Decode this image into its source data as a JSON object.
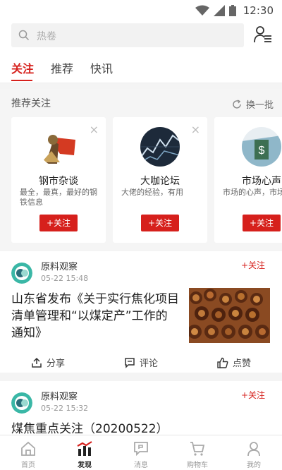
{
  "status_bar": {
    "time": "12:30"
  },
  "search": {
    "placeholder": "热卷"
  },
  "tabs": [
    {
      "label": "关注",
      "active": true
    },
    {
      "label": "推荐",
      "active": false
    },
    {
      "label": "快讯",
      "active": false
    }
  ],
  "recommend": {
    "title": "推荐关注",
    "refresh_label": "换一批",
    "cards": [
      {
        "name": "钢市杂谈",
        "desc": "最全，最真，最好的钢铁信息",
        "follow_label": "+关注",
        "close": "×"
      },
      {
        "name": "大咖论坛",
        "desc": "大佬的经验，有用",
        "follow_label": "+关注",
        "close": "×"
      },
      {
        "name": "市场心声",
        "desc": "市场的心声，市场动态",
        "follow_label": "+关注",
        "close": "×"
      }
    ]
  },
  "feed": [
    {
      "author": "原料观察",
      "time": "05-22 15:48",
      "follow_label": "+关注",
      "headline": "山东省发布《关于实行焦化项目清单管理和“以煤定产”工作的通知》",
      "actions": {
        "share": "分享",
        "comment": "评论",
        "like": "点赞"
      }
    },
    {
      "author": "原料观察",
      "time": "05-22 15:32",
      "follow_label": "+关注",
      "headline": "煤焦重点关注（20200522）"
    }
  ],
  "bottom_nav": [
    {
      "label": "首页",
      "active": false
    },
    {
      "label": "发现",
      "active": true
    },
    {
      "label": "消息",
      "active": false
    },
    {
      "label": "购物车",
      "active": false
    },
    {
      "label": "我的",
      "active": false
    }
  ],
  "colors": {
    "accent": "#d6201c",
    "background": "#f4f4f4"
  }
}
